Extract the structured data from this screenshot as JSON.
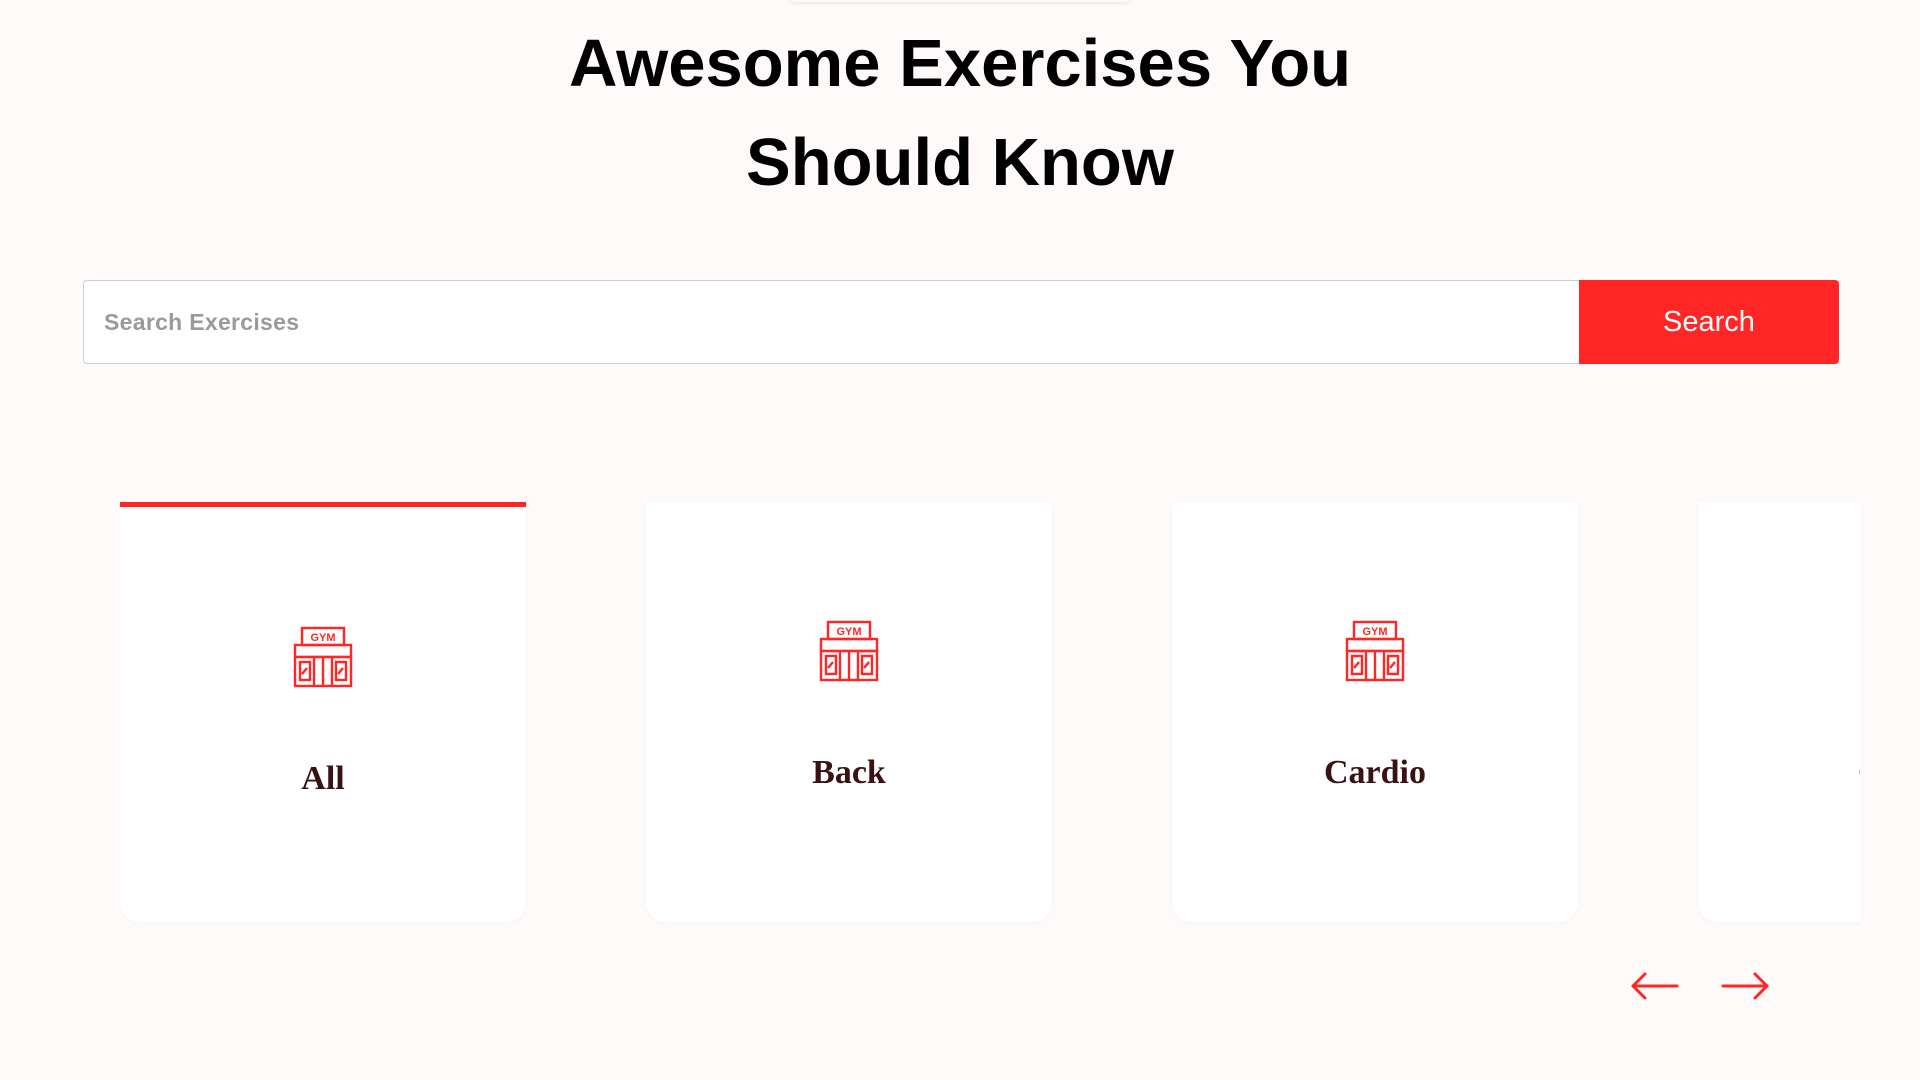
{
  "header": {
    "title_line1": "Awesome Exercises You",
    "title_line2": "Should Know"
  },
  "search": {
    "placeholder": "Search Exercises",
    "value": "",
    "button_label": "Search"
  },
  "categories": {
    "active_index": 0,
    "items": [
      {
        "label": "All",
        "icon": "gym-icon"
      },
      {
        "label": "Back",
        "icon": "gym-icon"
      },
      {
        "label": "Cardio",
        "icon": "gym-icon"
      },
      {
        "label": "C",
        "icon": "gym-icon"
      }
    ]
  },
  "carousel_nav": {
    "prev_icon": "arrow-left-icon",
    "next_icon": "arrow-right-icon"
  },
  "colors": {
    "accent": "#ff2625",
    "background": "#fffafa",
    "card_text": "#3a1212"
  }
}
